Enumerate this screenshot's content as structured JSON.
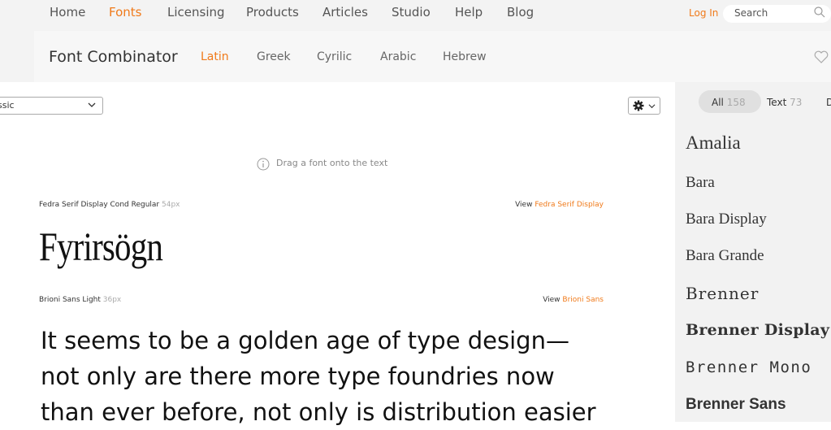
{
  "topnav": {
    "items": [
      "Home",
      "Fonts",
      "Licensing",
      "Products",
      "Articles",
      "Studio",
      "Help",
      "Blog"
    ],
    "active": "Fonts",
    "login_label": "Log In",
    "search_placeholder": "Search"
  },
  "subheader": {
    "title": "Font Combinator",
    "tabs": [
      "Latin",
      "Greek",
      "Cyrilic",
      "Arabic",
      "Hebrew"
    ],
    "active_tab": "Latin"
  },
  "canvas": {
    "preset_select": "ssic",
    "hint": "Drag a font onto the text",
    "specimens": [
      {
        "font_name": "Fedra Serif Display Cond Regular",
        "size": "54px",
        "view_prefix": "View",
        "view_link": "Fedra Serif Display",
        "text": "Fyrirsögn"
      },
      {
        "font_name": "Brioni Sans Light",
        "size": "36px",
        "view_prefix": "View",
        "view_link": "Brioni Sans",
        "lines": [
          "It seems to be a golden age of type design—",
          "not only are there more type foundries now",
          "than ever before, not only is distribution easier"
        ]
      }
    ]
  },
  "rightpanel": {
    "filters": [
      {
        "label": "All",
        "count": "158"
      },
      {
        "label": "Text",
        "count": "73"
      },
      {
        "label": "D",
        "count": ""
      }
    ],
    "fonts": [
      "Amalia",
      "Bara",
      "Bara Display",
      "Bara Grande",
      "Brenner",
      "Brenner Display",
      "Brenner Mono",
      "Brenner Sans"
    ]
  },
  "colors": {
    "accent": "#f07a1a",
    "nav_bg": "#f3f3f3",
    "panel_bg": "#f2f2f2"
  }
}
